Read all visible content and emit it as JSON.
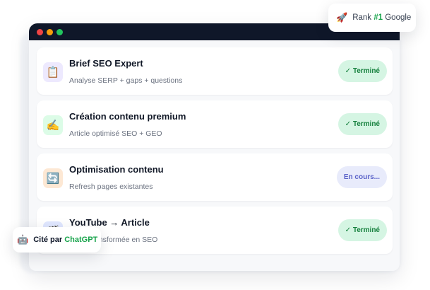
{
  "window": {
    "dots": [
      "#ef4444",
      "#f59e0b",
      "#22c55e"
    ]
  },
  "tasks": [
    {
      "title": "Brief SEO Expert",
      "subtitle": "Analyse SERP + gaps + questions",
      "icon": "clipboard-icon",
      "icon_glyph": "📋",
      "icon_bg": "#ede9fe",
      "status": "✓ Terminé",
      "status_type": "done"
    },
    {
      "title": "Création contenu premium",
      "subtitle": "Article optimisé SEO + GEO",
      "icon": "writing-hand-icon",
      "icon_glyph": "✍️",
      "icon_bg": "#dcfce7",
      "status": "✓ Terminé",
      "status_type": "done"
    },
    {
      "title": "Optimisation contenu",
      "subtitle": "Refresh pages existantes",
      "icon": "refresh-icon",
      "icon_glyph": "🔄",
      "icon_bg": "#fde8d4",
      "status": "En cours...",
      "status_type": "progress"
    },
    {
      "title": "YouTube → Article",
      "subtitle": "Vidéo transformée en SEO",
      "icon": "video-icon",
      "icon_glyph": "🎬",
      "icon_bg": "#e0e7ff",
      "status": "✓ Terminé",
      "status_type": "done"
    }
  ],
  "rank_badge": {
    "icon": "rocket-icon",
    "icon_glyph": "🚀",
    "prefix": "Rank ",
    "highlight": "#1",
    "suffix": " Google"
  },
  "cite_badge": {
    "icon": "robot-icon",
    "icon_glyph": "🤖",
    "prefix": "Cité par ",
    "highlight": "ChatGPT"
  },
  "colors": {
    "titlebar": "#0f1729",
    "done_bg": "#d5f5e3",
    "done_text": "#15803d",
    "progress_bg": "#e8ebfb",
    "progress_text": "#5b63c9",
    "accent_green": "#16a34a"
  }
}
